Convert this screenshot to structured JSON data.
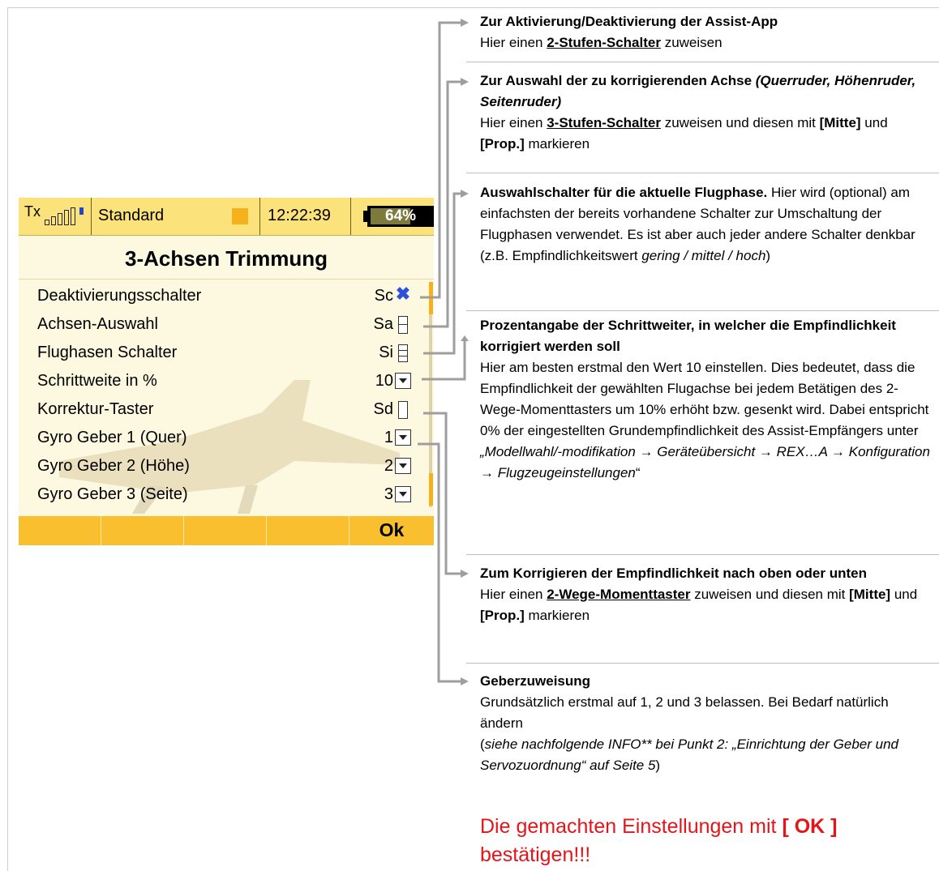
{
  "screen": {
    "status": {
      "tx_label": "Tx",
      "model_name": "Standard",
      "time": "12:22:39",
      "battery": "64%",
      "battery_level": 0.64
    },
    "title": "3-Achsen Trimmung",
    "rows": [
      {
        "label": "Deaktivierungsschalter",
        "value": "Sc",
        "control": "x-mark"
      },
      {
        "label": "Achsen-Auswahl",
        "value": "Sa",
        "control": "switch-3pos"
      },
      {
        "label": "Flughasen Schalter",
        "value": "Si",
        "control": "switch-3pos"
      },
      {
        "label": "Schrittweite in %",
        "value": "10",
        "control": "dropdown"
      },
      {
        "label": "Korrektur-Taster",
        "value": "Sd",
        "control": "switch-2pos"
      },
      {
        "label": "Gyro Geber 1 (Quer)",
        "value": "1",
        "control": "dropdown"
      },
      {
        "label": "Gyro Geber 2 (Höhe)",
        "value": "2",
        "control": "dropdown"
      },
      {
        "label": "Gyro Geber 3 (Seite)",
        "value": "3",
        "control": "dropdown"
      }
    ],
    "buttons": [
      "",
      "",
      "",
      "",
      "Ok"
    ],
    "colors": {
      "status_bg": "#fbe27a",
      "button_bar": "#f9bf2e",
      "accent": "#2b52d8"
    }
  },
  "annotations": {
    "a1": {
      "title": "Zur Aktivierung/Deaktivierung der Assist-App",
      "pre": "Hier einen ",
      "key": "2-Stufen-Schalter",
      "post": " zuweisen"
    },
    "a2": {
      "title": "Zur Auswahl der zu korrigierenden Achse ",
      "title_italic": "(Querruder, Höhenruder, Seitenruder)",
      "pre": "Hier einen ",
      "key": "3-Stufen-Schalter",
      "mid": " zuweisen und diesen mit ",
      "b1": "[Mitte]",
      "and": " und ",
      "b2": "[Prop.]",
      "post": " markieren"
    },
    "a3": {
      "title": "Auswahlschalter für die aktuelle Flugphase.",
      "text": " Hier wird (optional) am einfachsten der bereits vorhandene Schalter zur Umschaltung der Flugphasen verwendet. Es ist aber auch jeder andere Schalter denkbar (z.B. Empfindlichkeitswert ",
      "italic": "gering / mittel / hoch",
      "end": ")"
    },
    "a4": {
      "title": "Prozentangabe der Schrittweiter, in welcher die Empfindlichkeit korrigiert werden soll",
      "text": "Hier am besten erstmal den Wert 10 einstellen. Dies bedeutet, dass die Empfindlichkeit der gewählten Flugachse bei jedem Betätigen des 2-Wege-Momenttasters um 10% erhöht bzw. gesenkt wird. Dabei entspricht 0% der eingestellten Grundempfindlichkeit des Assist-Empfängers unter ",
      "italic": "„Modellwahl/-modifikation → Geräteübersicht → REX…A → Konfiguration → Flugzeugeinstellungen",
      "end": "“"
    },
    "a5": {
      "title": "Zum Korrigieren der Empfindlichkeit nach oben oder unten",
      "pre": "Hier einen ",
      "key": "2-Wege-Momenttaster",
      "mid": " zuweisen und diesen mit ",
      "b1": "[Mitte]",
      "and": " und ",
      "b2": "[Prop.]",
      "post": " markieren"
    },
    "a6": {
      "title": "Geberzuweisung",
      "text": "Grundsätzlich erstmal auf 1, 2 und 3 belassen. Bei Bedarf natürlich ändern",
      "pre": "(",
      "italic": "siehe nachfolgende INFO** bei Punkt 2: „Einrichtung der Geber und Servozuordnung“ auf Seite 5",
      "end": ")"
    },
    "final": {
      "pre": "Die gemachten Einstellungen mit ",
      "key": "[ OK ]",
      "post": " bestätigen!!!"
    }
  }
}
